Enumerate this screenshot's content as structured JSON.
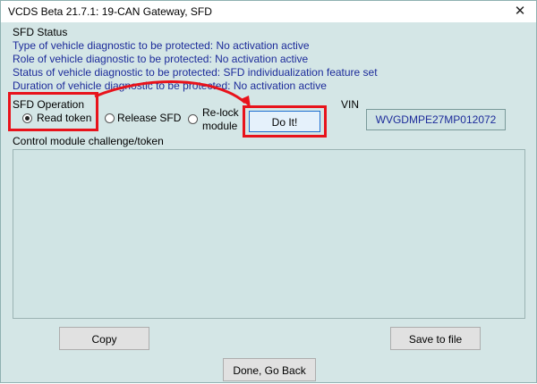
{
  "window": {
    "title": "VCDS Beta 21.7.1: 19-CAN Gateway,  SFD",
    "close_glyph": "✕"
  },
  "sfd_status": {
    "heading": "SFD Status",
    "lines": [
      "Type of vehicle diagnostic to be protected: No activation active",
      "Role of vehicle diagnostic to be protected: No activation active",
      "Status of vehicle diagnostic to be protected: SFD individualization feature set",
      "Duration of vehicle diagnostic to be protected: No activation active"
    ]
  },
  "sfd_operation": {
    "label": "SFD Operation",
    "options": [
      {
        "label": "Read token",
        "selected": true
      },
      {
        "label": "Release SFD",
        "selected": false
      },
      {
        "label_line1": "Re-lock",
        "label_line2": "module",
        "selected": false
      }
    ]
  },
  "do_it_label": "Do It!",
  "vin": {
    "label": "VIN",
    "value": "WVGDMPE27MP012072"
  },
  "token": {
    "label": "Control module challenge/token",
    "value": ""
  },
  "buttons": {
    "copy": "Copy",
    "save": "Save to file",
    "done": "Done, Go Back"
  },
  "colors": {
    "window_bg": "#d4e6e6",
    "status_text": "#1c2b9a",
    "highlight": "#e8131b"
  },
  "icons": {
    "close": "close-icon",
    "radio": "radio-icon",
    "annotation_arrow": "arrow-icon"
  }
}
